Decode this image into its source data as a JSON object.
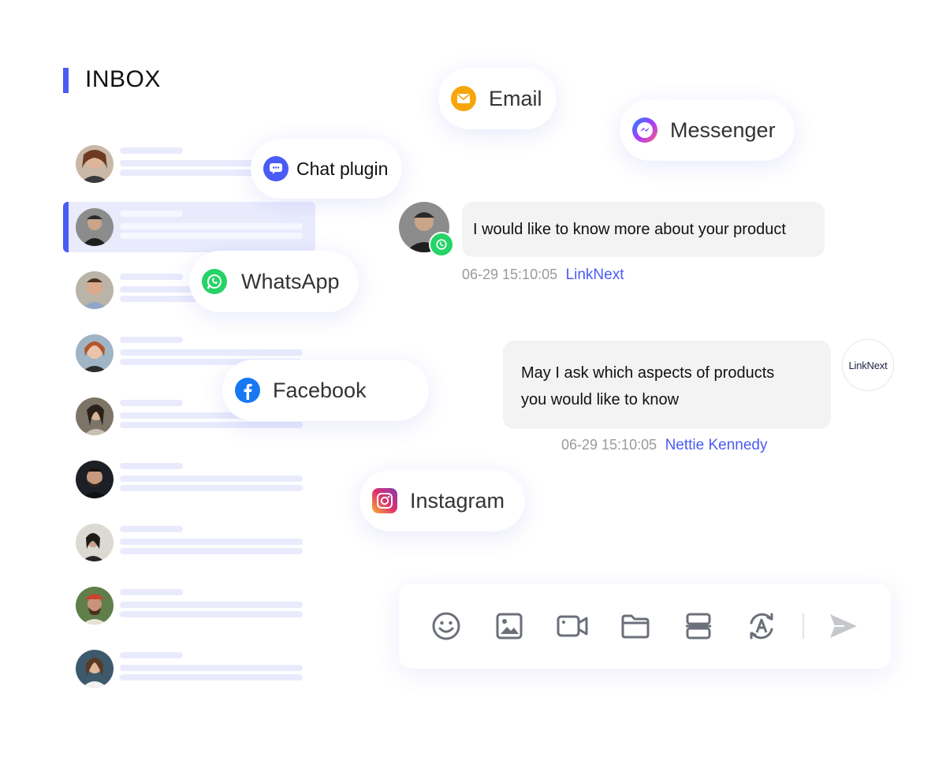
{
  "inbox": {
    "title": "INBOX"
  },
  "channels": {
    "email": "Email",
    "messenger": "Messenger",
    "chat_plugin": "Chat plugin",
    "whatsapp": "WhatsApp",
    "facebook": "Facebook",
    "instagram": "Instagram"
  },
  "messages": [
    {
      "text": "I would like to know more about your product",
      "time": "06-29 15:10:05",
      "sender": "LinkNext"
    },
    {
      "text_line1": "May I ask which aspects of products",
      "text_line2": "you would like to know",
      "time": "06-29 15:10:05",
      "sender": "Nettie Kennedy"
    }
  ],
  "brand_avatar": {
    "text": "LinkNext"
  },
  "toolbar": {
    "icons": [
      "emoji-icon",
      "image-icon",
      "video-icon",
      "folder-icon",
      "template-icon",
      "translate-icon",
      "send-icon"
    ]
  },
  "colors": {
    "accent": "#4a5cf5",
    "selected_row": "#e9ebfd",
    "bubble": "#f3f3f4",
    "whatsapp": "#25d366",
    "email": "#f6a609",
    "facebook": "#1877f2"
  }
}
